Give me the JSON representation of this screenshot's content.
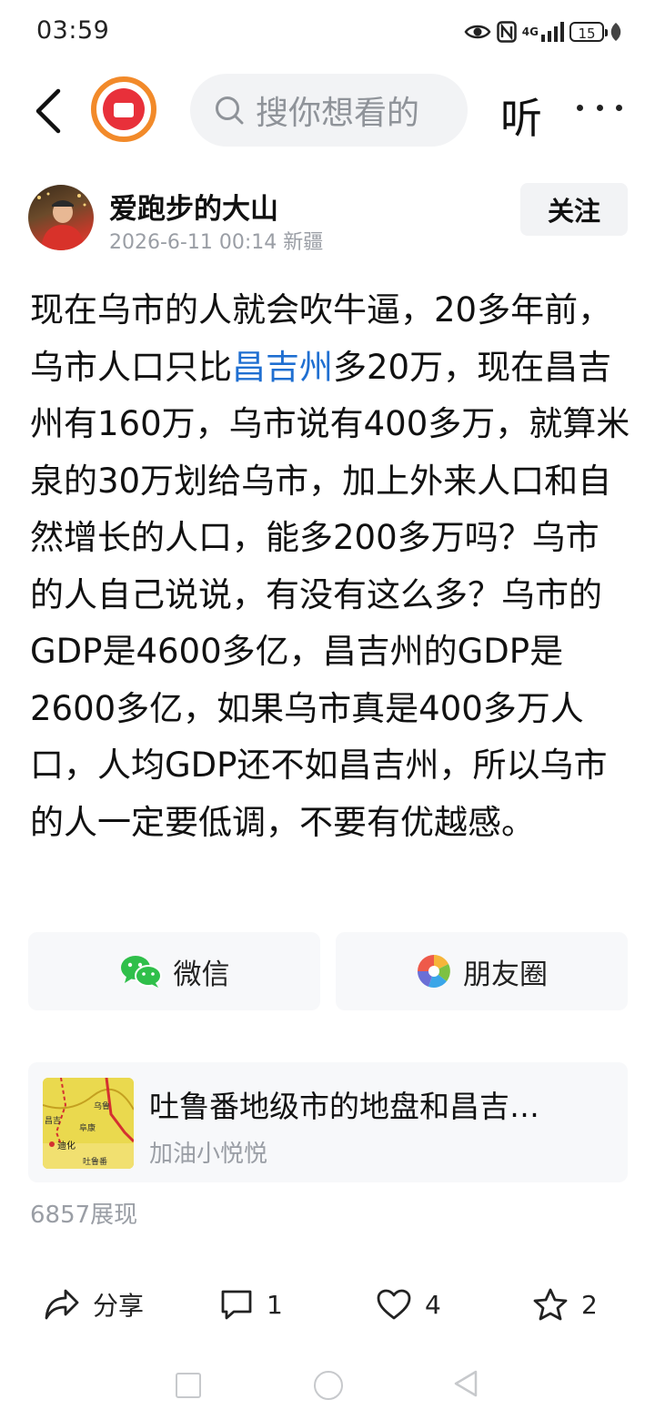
{
  "status_bar": {
    "time": "03:59",
    "network": "4G",
    "battery": "15"
  },
  "top_nav": {
    "search_placeholder": "搜你想看的",
    "listen_label": "听"
  },
  "author": {
    "name": "爱跑步的大山",
    "date": "2026-6-11 00:14",
    "location": "新疆",
    "follow_label": "关注"
  },
  "article": {
    "text_before_link": "现在乌市的人就会吹牛逼，20多年前，乌市人口只比",
    "link_text": "昌吉州",
    "text_after_link": "多20万，现在昌吉州有160万，乌市说有400多万，就算米泉的30万划给乌市，加上外来人口和自然增长的人口，能多200多万吗？乌市的人自己说说，有没有这么多？乌市的GDP是4600多亿，昌吉州的GDP是2600多亿，如果乌市真是400多万人口，人均GDP还不如昌吉州，所以乌市的人一定要低调，不要有优越感。"
  },
  "share": {
    "wechat_label": "微信",
    "moments_label": "朋友圈"
  },
  "related": {
    "title": "吐鲁番地级市的地盘和昌吉…",
    "author": "加油小悦悦",
    "map_labels": [
      "昌吉",
      "阜康",
      "乌鲁",
      "迪化",
      "吐鲁番"
    ]
  },
  "views": "6857展现",
  "actions": {
    "share_label": "分享",
    "comment_count": "1",
    "like_count": "4",
    "favorite_count": "2"
  },
  "colors": {
    "link": "#1f6fd1",
    "wechat_green": "#2fbf4a",
    "logo_ring": "#f28a2a",
    "logo_red": "#e8303a"
  }
}
